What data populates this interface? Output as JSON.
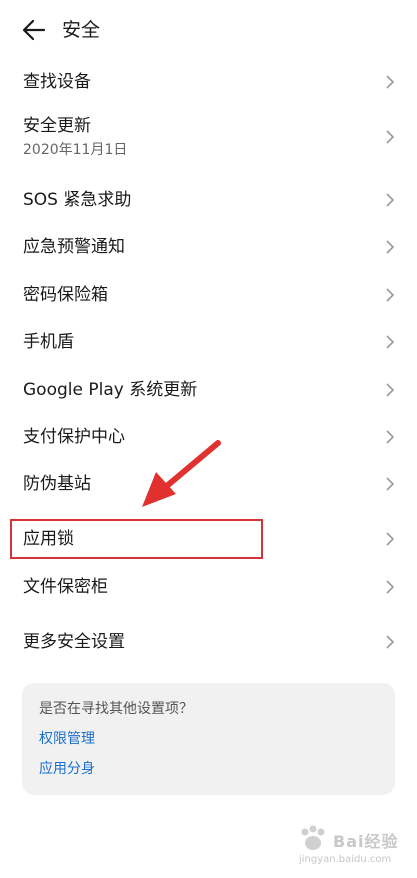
{
  "header": {
    "title": "安全",
    "back_icon": "arrow-left-icon"
  },
  "rows": [
    {
      "label": "查找设备"
    },
    {
      "label": "安全更新",
      "sub": "2020年11月1日"
    },
    {
      "label": "SOS 紧急求助"
    },
    {
      "label": "应急预警通知"
    },
    {
      "label": "密码保险箱"
    },
    {
      "label": "手机盾"
    },
    {
      "label": "Google Play 系统更新"
    },
    {
      "label": "支付保护中心"
    },
    {
      "label": "防伪基站"
    },
    {
      "label": "应用锁"
    },
    {
      "label": "文件保密柜"
    },
    {
      "label": "更多安全设置"
    }
  ],
  "suggest": {
    "question": "是否在寻找其他设置项？",
    "links": [
      "权限管理",
      "应用分身"
    ]
  },
  "watermark": {
    "text": "Bai经验",
    "url": "jingyan.baidu.com"
  },
  "colors": {
    "highlight": "#d8323a",
    "link": "#1a6fc9",
    "card_bg": "#f1f1f1"
  }
}
